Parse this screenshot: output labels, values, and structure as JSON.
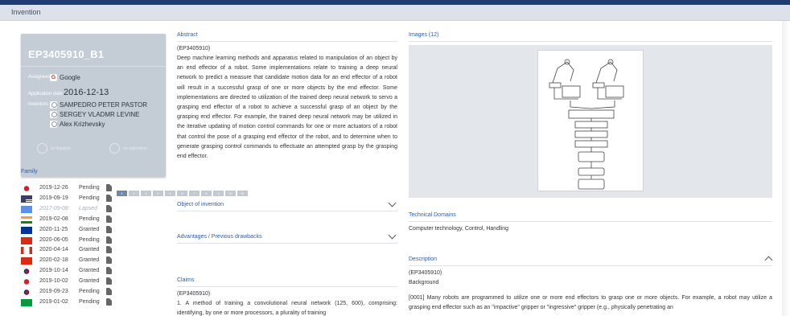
{
  "header": {
    "section_label": "Invention"
  },
  "patent": {
    "id": "EP3405910_B1",
    "assignees_label": "Assignees",
    "assignee": "Google",
    "application_date_label": "Application date",
    "application_date": "2016-12-13",
    "inventors_label": "Inventors",
    "inventors": [
      "SAMPEDRO PETER PASTOR",
      "SERGEY VLADMR LEVINE",
      "Alex Krizhevsky"
    ],
    "litigation_label": "no litigation",
    "opposition_label": "no opposition"
  },
  "family": {
    "heading": "Family",
    "rows": [
      {
        "flag": "jp",
        "date": "2019-12-26",
        "status": "Pending"
      },
      {
        "flag": "us",
        "date": "2019-09-19",
        "status": "Pending"
      },
      {
        "flag": "wo",
        "date": "2017-09-08",
        "status": "Lapsed"
      },
      {
        "flag": "in",
        "date": "2019-02-08",
        "status": "Pending"
      },
      {
        "flag": "eu",
        "date": "2020-11-25",
        "status": "Granted"
      },
      {
        "flag": "cn",
        "date": "2020-06-05",
        "status": "Pending"
      },
      {
        "flag": "ca",
        "date": "2020-04-14",
        "status": "Granted"
      },
      {
        "flag": "cn",
        "date": "2020-02-18",
        "status": "Granted"
      },
      {
        "flag": "kr",
        "date": "2019-10-14",
        "status": "Granted"
      },
      {
        "flag": "jp",
        "date": "2019-10-02",
        "status": "Granted"
      },
      {
        "flag": "kr",
        "date": "2019-09-23",
        "status": "Pending"
      },
      {
        "flag": "br",
        "date": "2019-01-02",
        "status": "Pending"
      }
    ]
  },
  "abstract": {
    "heading": "Abstract",
    "ref": "(EP3405910)",
    "text": "Deep machine learning methods and apparatus related to manipulation of an object by an end effector of a robot. Some implementations relate to training a deep neural network to predict a measure that candidate motion data for an end effector of a robot will result in a successful grasp of one or more objects by the end effector. Some implementations are directed to utilization of the trained deep neural network to servo a grasping end effector of a robot to achieve a successful grasp of an object by the grasping end effector. For example, the trained deep neural network may be utilized in the iterative updating of motion control commands for one or more actuators of a robot that control the pose of a grasping end effector of the robot, and to determine when to generate grasping control commands to effectuate an attempted grasp by the grasping end effector."
  },
  "object_of_invention": {
    "heading": "Object of invention"
  },
  "advantages": {
    "heading": "Advantages / Previous drawbacks"
  },
  "claims": {
    "heading": "Claims",
    "ref": "(EP3405910)",
    "text": "1. A method of training a convolutional neural network (125, 600), comprising: identifying, by one or more processors, a plurality of training"
  },
  "images": {
    "heading": "Images (12)",
    "pages": [
      "1",
      "2",
      "3",
      "4",
      "5",
      "6",
      "7",
      "8",
      "9",
      "10",
      "11"
    ],
    "active_page": 0
  },
  "technical_domains": {
    "heading": "Technical Domains",
    "text": "Computer technology, Control, Handling"
  },
  "description": {
    "heading": "Description",
    "ref": "(EP3405910)",
    "subheading": "Background",
    "text": "[0001] Many robots are programmed to utilize one or more end effectors to grasp one or more objects. For example, a robot may utilize a grasping end effector such as an \"impactive\" gripper or \"ingressive\" gripper (e.g., physically penetrating an"
  },
  "colors": {
    "topbar": "#1f3d72",
    "accent": "#2f5fa8",
    "card": "#c4ccd6"
  }
}
